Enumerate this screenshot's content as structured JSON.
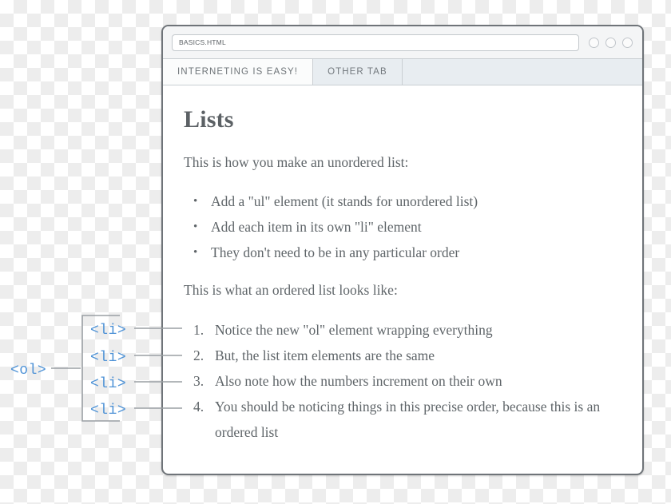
{
  "browser": {
    "url_bar": {
      "value": "BASICS.HTML",
      "placeholder": "Enter address"
    },
    "window_controls": [
      {
        "name": "minimize-circle"
      },
      {
        "name": "maximize-circle"
      },
      {
        "name": "close-circle"
      }
    ],
    "tabs": [
      {
        "label": "INTERNETING IS EASY!",
        "active": true
      },
      {
        "label": "OTHER TAB",
        "active": false
      }
    ]
  },
  "page": {
    "title": "Lists",
    "intro_unordered": "This is how you make an unordered list:",
    "unordered_items": [
      "Add a \"ul\" element (it stands for unordered list)",
      "Add each item in its own \"li\" element",
      "They don't need to be in any particular order"
    ],
    "intro_ordered": "This is what an ordered list looks like:",
    "ordered_items": [
      "Notice the new \"ol\" element wrapping everything",
      "But, the list item elements are the same",
      "Also note how the numbers increment on their own",
      "You should be noticing things in this precise order, because this is an ordered list"
    ]
  },
  "annotations": {
    "accent_color": "#4e92d6",
    "ol_label": "<ol>",
    "li_labels": [
      "<li>",
      "<li>",
      "<li>",
      "<li>"
    ]
  }
}
